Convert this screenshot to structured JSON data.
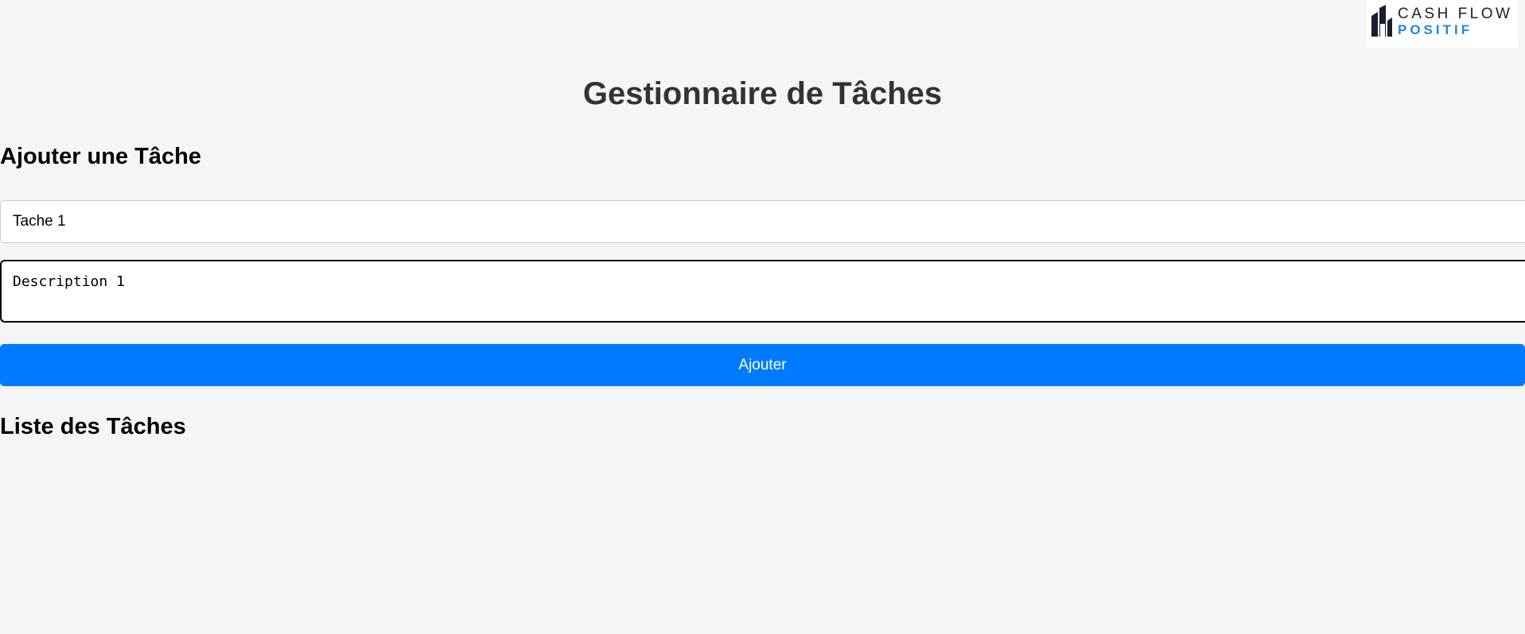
{
  "brand": {
    "line1": "CASH FLOW",
    "line2": "POSITIF",
    "text_color": "#1a1f2e",
    "accent_color": "#1e88e5",
    "icon": "building-icon"
  },
  "app": {
    "title": "Gestionnaire de Tâches"
  },
  "add_section": {
    "heading": "Ajouter une Tâche",
    "title_value": "Tache 1",
    "description_value": "Description 1",
    "submit_label": "Ajouter",
    "button_color": "#007bff"
  },
  "list_section": {
    "heading": "Liste des Tâches",
    "tasks": []
  }
}
